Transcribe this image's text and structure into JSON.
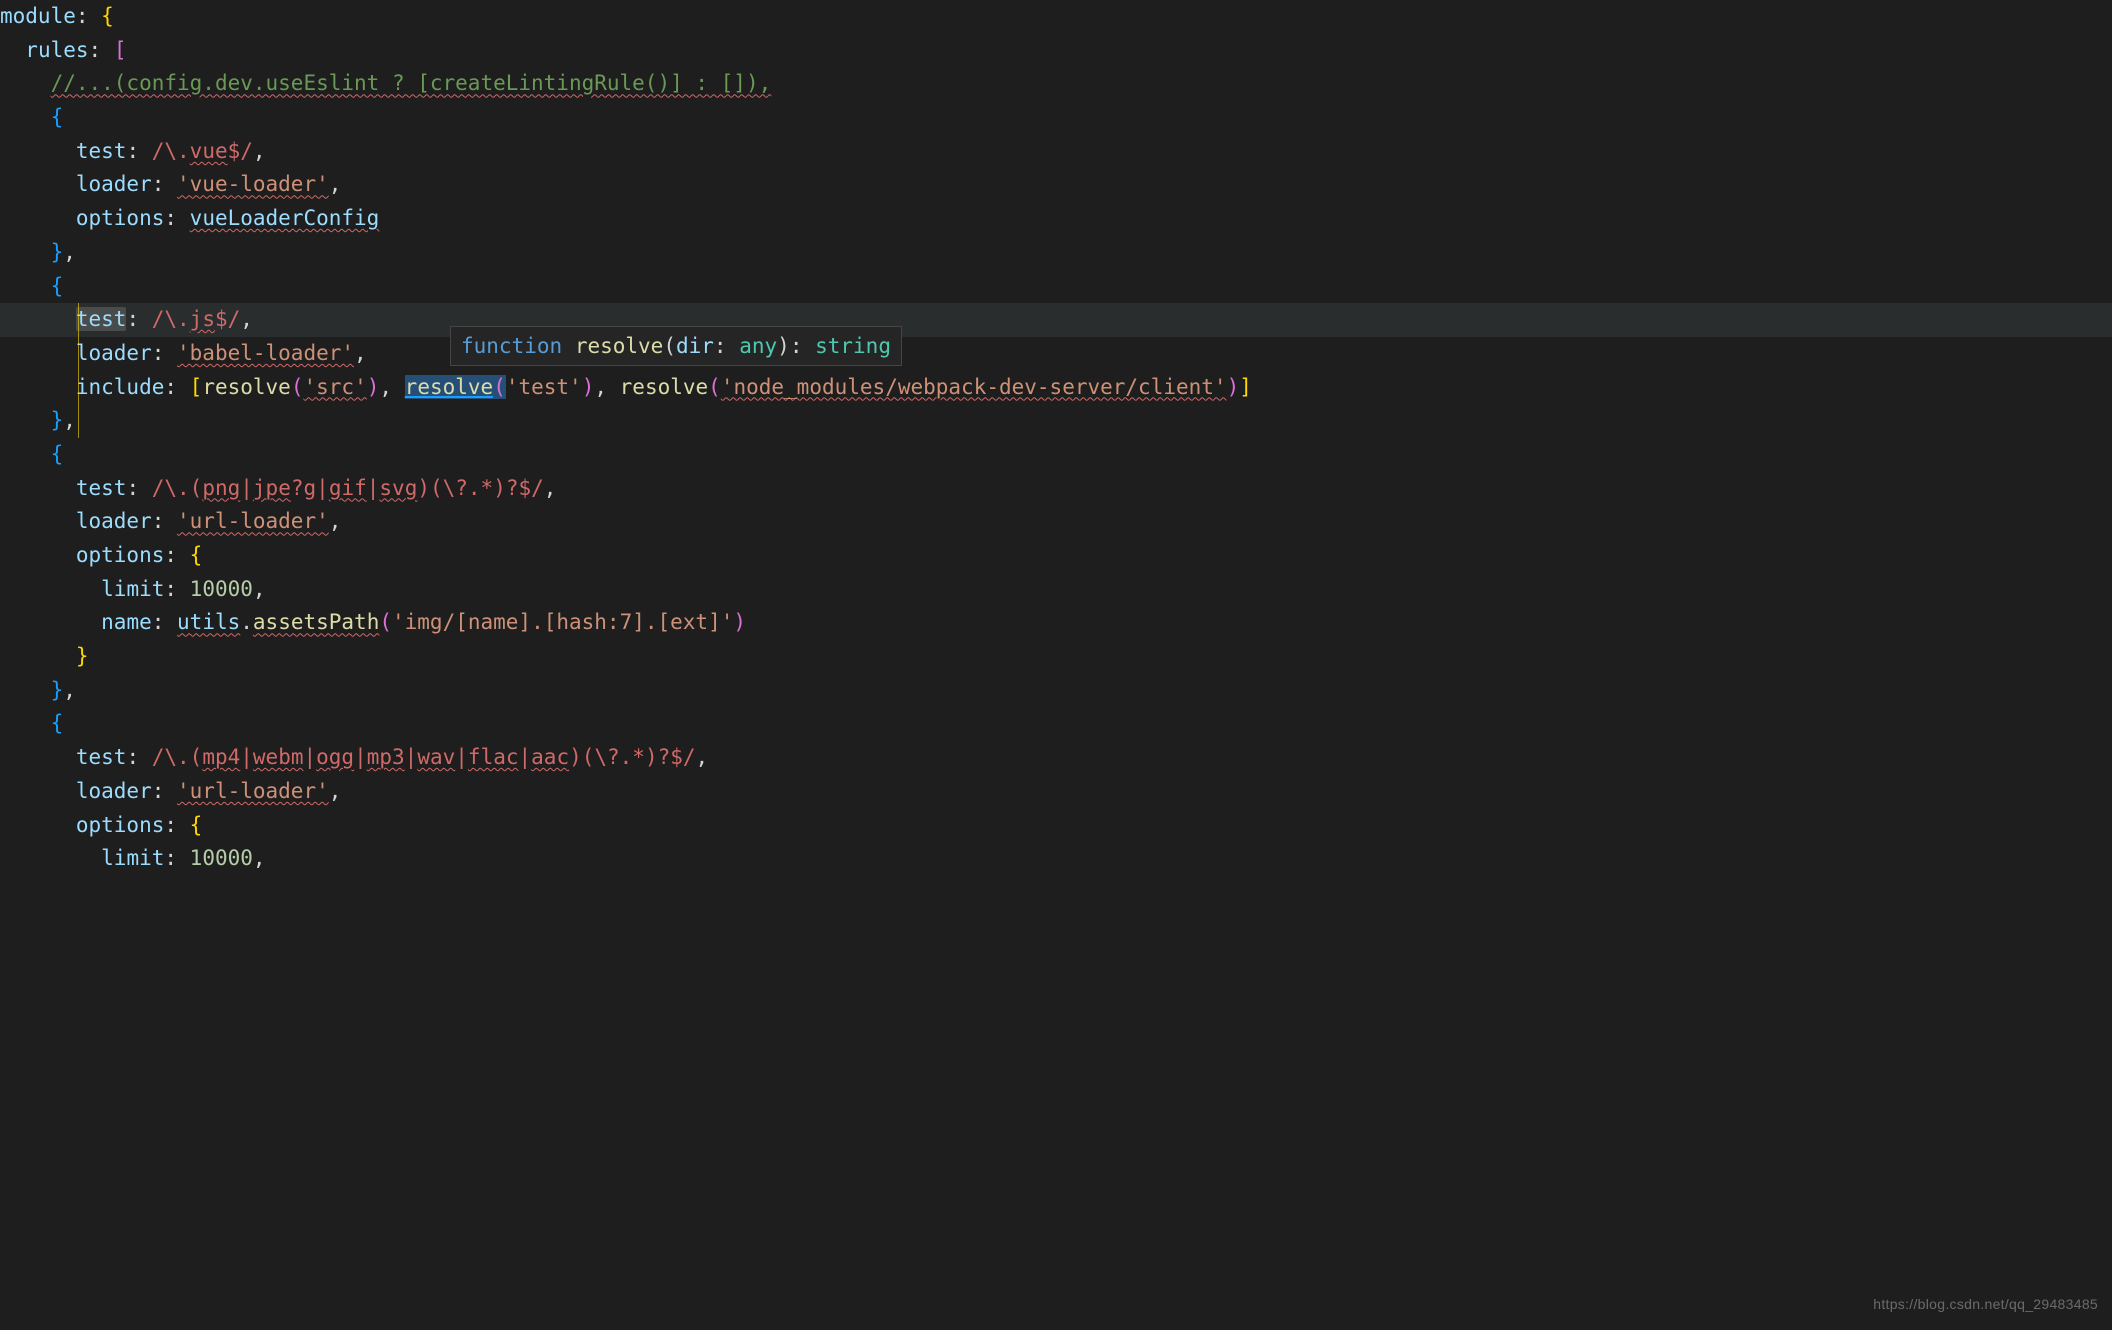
{
  "watermark": "https://blog.csdn.net/qq_29483485",
  "hover": {
    "kw": "function",
    "name": "resolve",
    "open": "(",
    "param": "dir",
    "colon": ": ",
    "ptype": "any",
    "close": ")",
    "ret_colon": ": ",
    "ret_type": "string"
  },
  "code": {
    "module_key": "module",
    "rules_key": "rules",
    "comment_line": "//...(config.dev.useEslint ? [createLintingRule()] : []),",
    "test_key": "test",
    "loader_key": "loader",
    "options_key": "options",
    "include_key": "include",
    "limit_key": "limit",
    "name_key": "name",
    "vue_regex_a": "/\\.",
    "vue_regex_b": "vue",
    "vue_regex_c": "$/",
    "vue_loader": "'vue-loader'",
    "vueLoaderConfig": "vueLoaderConfig",
    "js_regex_a": "/\\.",
    "js_regex_b": "js",
    "js_regex_c": "$/",
    "babel_loader": "'babel-loader'",
    "resolve": "resolve",
    "arg_src": "'src'",
    "arg_test": "'test'",
    "arg_node": "'node_modules/webpack-dev-server/client'",
    "img_regex_a": "/\\.(",
    "img_png": "png",
    "img_jpe": "jpe",
    "img_jpe_q": "?",
    "img_g": "g",
    "img_gif": "gif",
    "img_svg": "svg",
    "img_regex_b": ")(\\?.*)?$/",
    "url_loader": "'url-loader'",
    "limit_val": "10000",
    "utils": "utils",
    "assetsPath": "assetsPath",
    "img_path": "'img/[name].[hash:7].[ext]'",
    "media_regex_a": "/\\.(",
    "media_mp4": "mp4",
    "media_webm": "webm",
    "media_ogg": "ogg",
    "media_mp3": "mp3",
    "media_wav": "wav",
    "media_flac": "flac",
    "media_aac": "aac",
    "media_regex_b": ")(\\?.*)?$/"
  }
}
